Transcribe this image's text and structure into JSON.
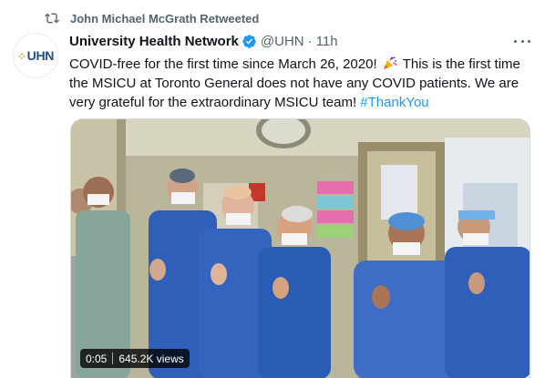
{
  "retweet": {
    "icon": "retweet-icon",
    "text": "John Michael McGrath Retweeted"
  },
  "author": {
    "avatar_text": "UHN",
    "name": "University Health Network",
    "verified_icon": "verified-badge-icon",
    "handle": "@UHN",
    "separator": "·",
    "time": "11h"
  },
  "more_icon": "more-options-icon",
  "tweet": {
    "text_part1": "COVID-free for the first time since March 26, 2020!",
    "emoji_icon": "party-popper-icon",
    "text_part2": "This is the first time the MSICU at Toronto General does not have any COVID patients. We are very grateful for the extraordinary MSICU team!",
    "hashtag": "#ThankYou"
  },
  "media": {
    "type": "video",
    "duration": "0:05",
    "views": "645.2K views"
  },
  "colors": {
    "accent": "#1d9bf0",
    "secondary_text": "#536471",
    "scrubs": "#2f5fb8"
  }
}
